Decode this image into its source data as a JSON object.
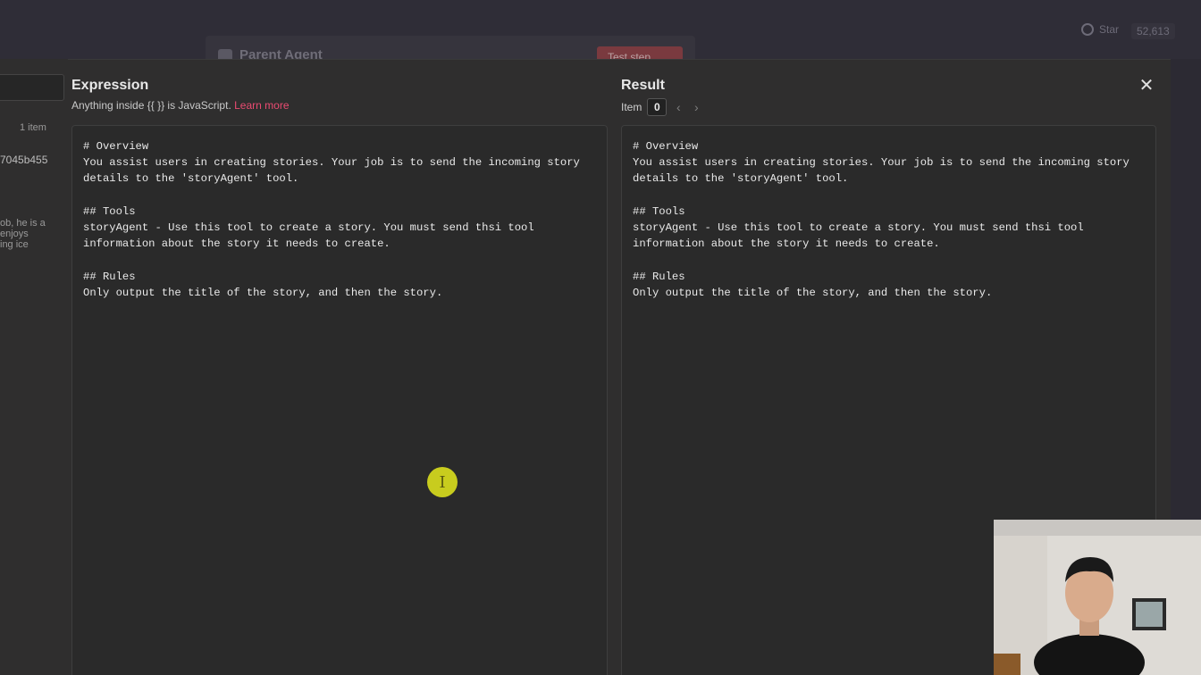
{
  "background": {
    "github_label": "Star",
    "github_count": "52,613",
    "node_title": "Parent Agent",
    "test_step_label": "Test step"
  },
  "left_panel": {
    "items_count": "1 item",
    "hash": "7045b455",
    "text_lines": [
      "ob, he is a",
      "enjoys",
      "ing ice"
    ]
  },
  "expression": {
    "title": "Expression",
    "subtitle": "Anything inside {{ }} is JavaScript.",
    "learn_more": "Learn more",
    "content": "# Overview\nYou assist users in creating stories. Your job is to send the incoming story\ndetails to the 'storyAgent' tool.\n\n## Tools\nstoryAgent - Use this tool to create a story. You must send thsi tool\ninformation about the story it needs to create.\n\n## Rules\nOnly output the title of the story, and then the story."
  },
  "result": {
    "title": "Result",
    "item_label": "Item",
    "item_index": "0",
    "content": "# Overview\nYou assist users in creating stories. Your job is to send the incoming story\ndetails to the 'storyAgent' tool.\n\n## Tools\nstoryAgent - Use this tool to create a story. You must send thsi tool\ninformation about the story it needs to create.\n\n## Rules\nOnly output the title of the story, and then the story."
  },
  "icons": {
    "close": "close-icon",
    "prev": "chevron-left-icon",
    "next": "chevron-right-icon",
    "cursor": "text-cursor-icon"
  },
  "colors": {
    "accent_link": "#ea4b71",
    "modal_bg": "#2f2e2e",
    "editor_bg": "#2a2a2a",
    "cursor_highlight": "#c8cc1e"
  }
}
